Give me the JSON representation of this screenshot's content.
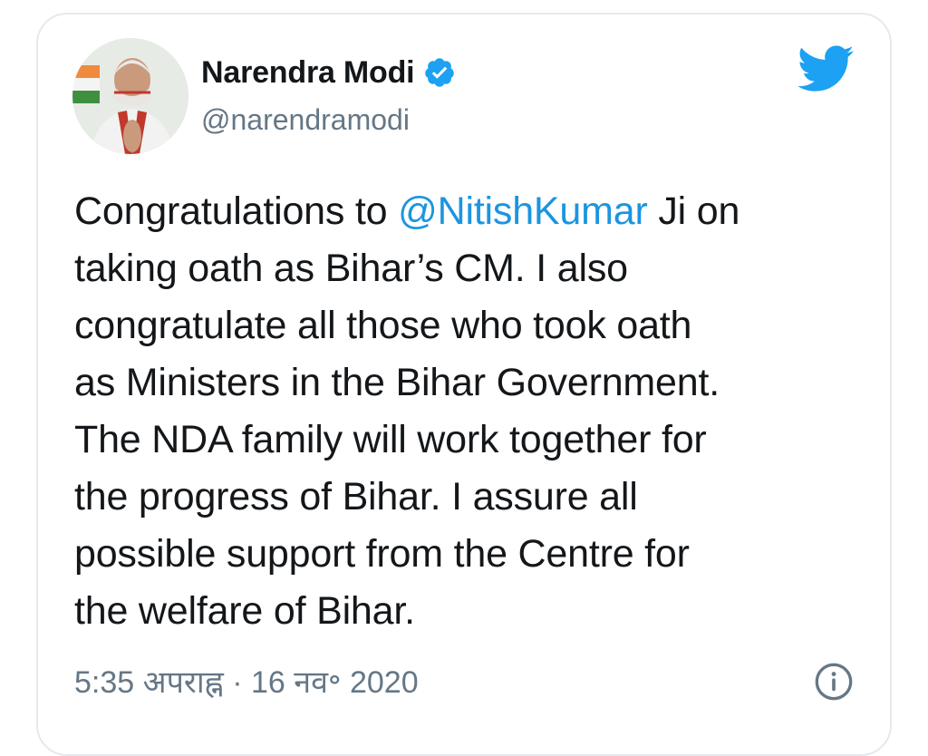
{
  "tweet": {
    "author": {
      "display_name": "Narendra Modi",
      "handle": "@narendramodi",
      "verified": true,
      "avatar_icon": "profile-photo"
    },
    "text_lines": [
      [
        "Congratulations to ",
        "@NitishKumar",
        " Ji on"
      ],
      [
        "taking oath as Bihar’s CM. I also"
      ],
      [
        "congratulate all those who took oath"
      ],
      [
        "as Ministers in the Bihar Government."
      ],
      [
        "The NDA family will work together for"
      ],
      [
        "the progress of Bihar. I assure all"
      ],
      [
        "possible support from the Centre for"
      ],
      [
        "the welfare of Bihar."
      ]
    ],
    "mention": "@NitishKumar",
    "time": "5:35 अपराह्न",
    "separator": "·",
    "date": "16 नव॰ 2020",
    "platform_icon": "twitter-bird-icon",
    "info_icon": "info-icon"
  },
  "colors": {
    "text": "#14171a",
    "secondary": "#657786",
    "accent": "#1da1f2",
    "mention": "#1b95e0",
    "border": "#e4e9ee"
  }
}
